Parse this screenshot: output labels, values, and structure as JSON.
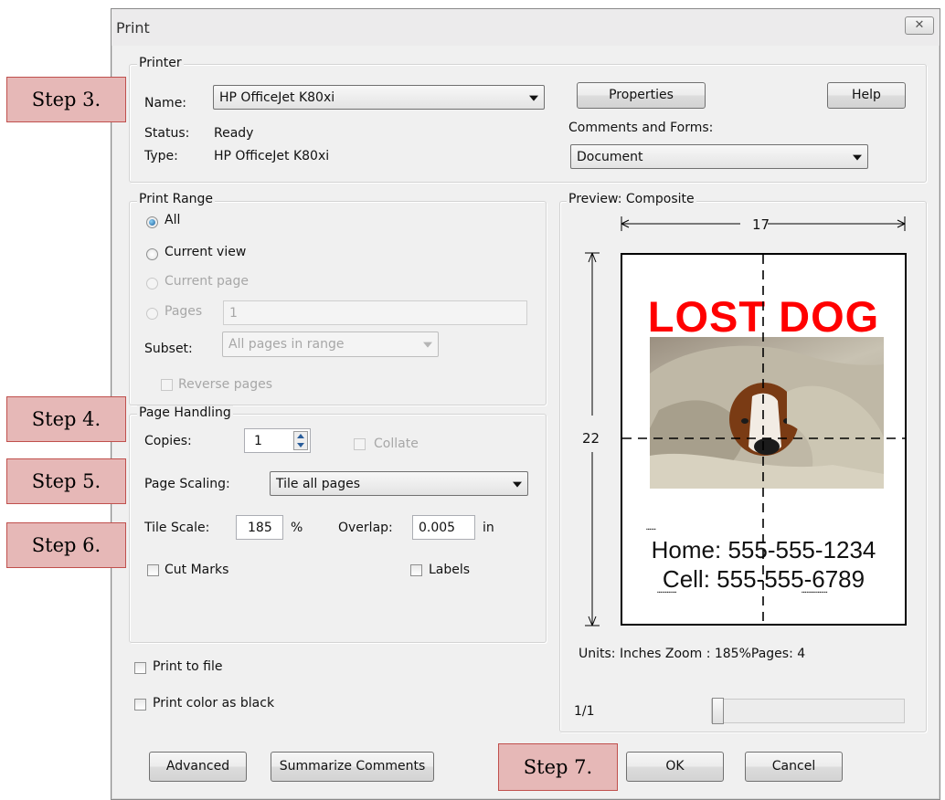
{
  "window": {
    "title": "Print",
    "close_icon": "close-icon"
  },
  "printer": {
    "legend": "Printer",
    "name_label": "Name:",
    "name_value": "HP OfficeJet K80xi",
    "status_label": "Status:",
    "status_value": "Ready",
    "type_label": "Type:",
    "type_value": "HP OfficeJet K80xi",
    "properties_button": "Properties",
    "help_button": "Help",
    "comments_label": "Comments and Forms:",
    "comments_value": "Document"
  },
  "print_range": {
    "legend": "Print Range",
    "all": "All",
    "current_view": "Current view",
    "current_page": "Current page",
    "pages": "Pages",
    "pages_value": "1",
    "subset_label": "Subset:",
    "subset_value": "All pages in range",
    "reverse_pages": "Reverse pages",
    "selected": "All"
  },
  "page_handling": {
    "legend": "Page Handling",
    "copies_label": "Copies:",
    "copies_value": "1",
    "collate": "Collate",
    "scaling_label": "Page Scaling:",
    "scaling_value": "Tile all pages",
    "tile_scale_label": "Tile Scale:",
    "tile_scale_value": "185",
    "tile_scale_unit": "%",
    "overlap_label": "Overlap:",
    "overlap_value": "0.005",
    "overlap_unit": "in",
    "cut_marks": "Cut Marks",
    "labels": "Labels"
  },
  "options": {
    "print_to_file": "Print to file",
    "print_color_as_black": "Print color as black"
  },
  "preview": {
    "legend": "Preview: Composite",
    "width_dim": "17",
    "height_dim": "22",
    "poster_title": "LOST DOG",
    "poster_home": "Home: 555-555-1234",
    "poster_cell": "Cell: 555-555-6789",
    "units_text": "Units: Inches Zoom : 185%Pages: 4",
    "page_counter": "1/1"
  },
  "footer": {
    "advanced_button": "Advanced",
    "summarize_button": "Summarize Comments",
    "ok_button": "OK",
    "cancel_button": "Cancel"
  },
  "steps": {
    "step3": "Step 3.",
    "step4": "Step 4.",
    "step5": "Step 5.",
    "step6": "Step 6.",
    "step7": "Step 7."
  },
  "colors": {
    "callout_fill": "#e6b8b7",
    "callout_border": "#c0504d",
    "poster_red": "#ff0000"
  }
}
